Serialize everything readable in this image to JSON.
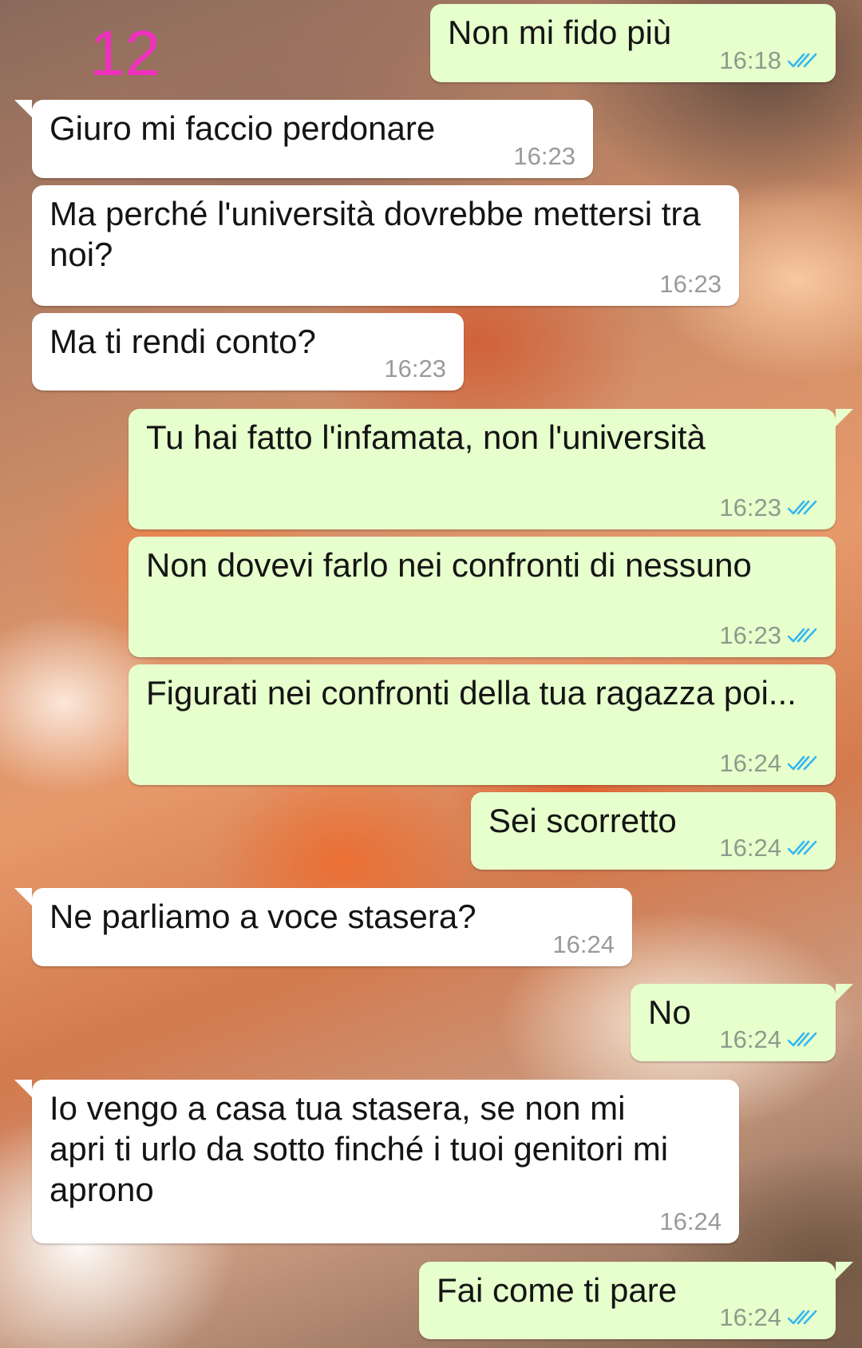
{
  "page_number": "12",
  "colors": {
    "page_number": "#ef2fbd",
    "incoming_bubble": "#ffffff",
    "outgoing_bubble": "#e6ffcc",
    "read_ticks": "#34b7f1"
  },
  "messages": [
    {
      "direction": "outgoing",
      "text": "Non mi fido più",
      "time": "16:18",
      "status_icon": "double-check-read-icon"
    },
    {
      "direction": "incoming",
      "text": "Giuro mi faccio perdonare",
      "time": "16:23"
    },
    {
      "direction": "incoming",
      "text": "Ma perché l'università dovrebbe mettersi tra noi?",
      "time": "16:23"
    },
    {
      "direction": "incoming",
      "text": "Ma ti rendi conto?",
      "time": "16:23"
    },
    {
      "direction": "outgoing",
      "text": "Tu hai fatto l'infamata, non l'università",
      "time": "16:23",
      "status_icon": "double-check-read-icon"
    },
    {
      "direction": "outgoing",
      "text": "Non dovevi farlo nei confronti di nessuno",
      "time": "16:23",
      "status_icon": "double-check-read-icon"
    },
    {
      "direction": "outgoing",
      "text": "Figurati nei confronti della tua ragazza poi...",
      "time": "16:24",
      "status_icon": "double-check-read-icon"
    },
    {
      "direction": "outgoing",
      "text": "Sei scorretto",
      "time": "16:24",
      "status_icon": "double-check-read-icon"
    },
    {
      "direction": "incoming",
      "text": "Ne parliamo a voce stasera?",
      "time": "16:24"
    },
    {
      "direction": "outgoing",
      "text": "No",
      "time": "16:24",
      "status_icon": "double-check-read-icon"
    },
    {
      "direction": "incoming",
      "text": "Io vengo a casa tua stasera, se non mi apri ti urlo da sotto finché i tuoi genitori mi aprono",
      "time": "16:24"
    },
    {
      "direction": "outgoing",
      "text": "Fai come ti pare",
      "time": "16:24",
      "status_icon": "double-check-read-icon"
    }
  ]
}
